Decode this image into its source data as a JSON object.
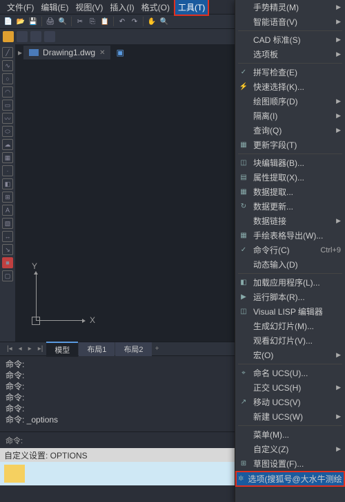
{
  "menubar": {
    "file": "文件(F)",
    "edit": "编辑(E)",
    "view": "视图(V)",
    "insert": "插入(I)",
    "format": "格式(O)",
    "tools": "工具(T)"
  },
  "doc": {
    "tab_name": "Drawing1.dwg"
  },
  "axis": {
    "x": "X",
    "y": "Y"
  },
  "layouts": {
    "model": "模型",
    "layout1": "布局1",
    "layout2": "布局2"
  },
  "cmd": {
    "lines": [
      "命令:",
      "命令:",
      "命令:",
      "命令:",
      "命令:",
      "命令: _options"
    ],
    "prompt": "命令:"
  },
  "status": {
    "text": "自定义设置: OPTIONS"
  },
  "menu": [
    {
      "label": "手势精灵(M)",
      "arrow": true
    },
    {
      "label": "智能语音(V)",
      "arrow": true
    },
    {
      "sep": true
    },
    {
      "label": "CAD 标准(S)",
      "arrow": true
    },
    {
      "label": "选项板",
      "arrow": true
    },
    {
      "sep": true
    },
    {
      "label": "拼写检查(E)",
      "icon": "✓"
    },
    {
      "label": "快速选择(K)...",
      "icon": "⚡"
    },
    {
      "label": "绘图顺序(D)",
      "arrow": true
    },
    {
      "label": "隔离(I)",
      "arrow": true
    },
    {
      "label": "查询(Q)",
      "arrow": true
    },
    {
      "label": "更新字段(T)",
      "icon": "▦"
    },
    {
      "sep": true
    },
    {
      "label": "块编辑器(B)...",
      "icon": "◫"
    },
    {
      "label": "属性提取(X)...",
      "icon": "▤"
    },
    {
      "label": "数据提取...",
      "icon": "▦"
    },
    {
      "label": "数据更新...",
      "icon": "↻"
    },
    {
      "label": "数据链接",
      "arrow": true
    },
    {
      "label": "手绘表格导出(W)...",
      "icon": "▦"
    },
    {
      "label": "命令行(C)",
      "shortcut": "Ctrl+9",
      "icon": "✓"
    },
    {
      "label": "动态输入(D)"
    },
    {
      "sep": true
    },
    {
      "label": "加载应用程序(L)...",
      "icon": "◧"
    },
    {
      "label": "运行脚本(R)...",
      "icon": "▶"
    },
    {
      "label": "Visual LISP 编辑器",
      "icon": "◫"
    },
    {
      "label": "生成幻灯片(M)..."
    },
    {
      "label": "观看幻灯片(V)..."
    },
    {
      "label": "宏(O)",
      "arrow": true
    },
    {
      "sep": true
    },
    {
      "label": "命名 UCS(U)...",
      "icon": "⌖"
    },
    {
      "label": "正交 UCS(H)",
      "arrow": true
    },
    {
      "label": "移动 UCS(V)",
      "icon": "↗"
    },
    {
      "label": "新建 UCS(W)",
      "arrow": true
    },
    {
      "sep": true
    },
    {
      "label": "菜单(M)..."
    },
    {
      "label": "自定义(Z)",
      "arrow": true
    },
    {
      "label": "草图设置(F)...",
      "icon": "⊞"
    },
    {
      "label": "选项(搜狐号@大水牛测绘",
      "icon": "✲",
      "hl": true
    }
  ]
}
